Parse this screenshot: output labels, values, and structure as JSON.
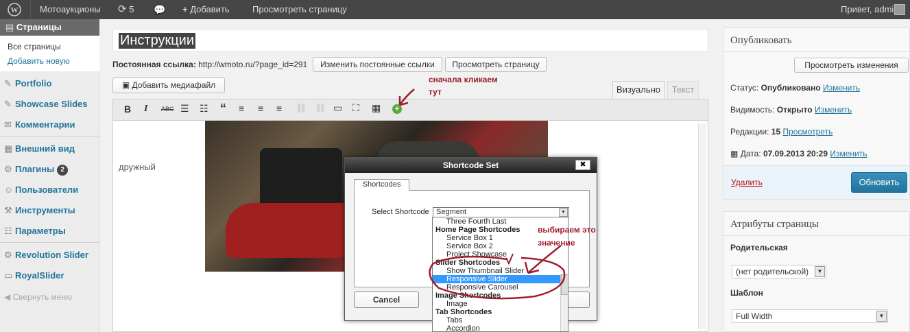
{
  "admin_bar": {
    "site_name": "Мотоаукционы",
    "updates_count": "5",
    "add_label": "Добавить",
    "view_page_label": "Просмотреть страницу",
    "greeting": "Привет, admin"
  },
  "sidebar": {
    "pages_label": "Страницы",
    "sub_items": [
      "Все страницы",
      "Добавить новую"
    ],
    "items": [
      {
        "label": "Portfolio",
        "icon": "✎"
      },
      {
        "label": "Showcase Slides",
        "icon": "✎"
      },
      {
        "label": "Комментарии",
        "icon": "✉"
      },
      {
        "label": "Внешний вид",
        "icon": "▦"
      },
      {
        "label": "Плагины",
        "icon": "⚙",
        "badge": "2"
      },
      {
        "label": "Пользователи",
        "icon": "☺"
      },
      {
        "label": "Инструменты",
        "icon": "⚒"
      },
      {
        "label": "Параметры",
        "icon": "☷"
      },
      {
        "label": "Revolution Slider",
        "icon": "⚙"
      },
      {
        "label": "RoyalSlider",
        "icon": "▭"
      }
    ],
    "collapse_label": "Свернуть меню"
  },
  "editor": {
    "title_value": "Инструкции",
    "permalink_label": "Постоянная ссылка:",
    "permalink_url": "http://wmoto.ru/?page_id=291",
    "change_permalink_btn": "Изменить постоянные ссылки",
    "view_page_btn": "Просмотреть страницу",
    "add_media_btn": "Добавить медиафайл",
    "tab_visual": "Визуально",
    "tab_text": "Текст",
    "content_text_fragment": "дружный"
  },
  "publish_box": {
    "title": "Опубликовать",
    "preview_btn": "Просмотреть изменения",
    "status_label": "Статус:",
    "status_value": "Опубликовано",
    "visibility_label": "Видимость:",
    "visibility_value": "Открыто",
    "revisions_label": "Редакции:",
    "revisions_value": "15",
    "revisions_link": "Просмотреть",
    "date_label": "Дата:",
    "date_value": "07.09.2013 20:29",
    "edit_link": "Изменить",
    "delete_link": "Удалить",
    "update_btn": "Обновить"
  },
  "attributes_box": {
    "title": "Атрибуты страницы",
    "parent_label": "Родительская",
    "parent_value": "(нет родительской)",
    "template_label": "Шаблон",
    "template_value": "Full Width"
  },
  "dialog": {
    "title": "Shortcode Set",
    "close": "✖",
    "tab": "Shortcodes",
    "select_label": "Select Shortcode",
    "selected_value": "Segment",
    "cancel_btn": "Cancel",
    "options": [
      {
        "text": "Three Fourth Last",
        "group": false,
        "highlight": false
      },
      {
        "text": "Home Page Shortcodes",
        "group": true,
        "highlight": false
      },
      {
        "text": "Service Box 1",
        "group": false,
        "highlight": false
      },
      {
        "text": "Service Box 2",
        "group": false,
        "highlight": false
      },
      {
        "text": "Project Showcase",
        "group": false,
        "highlight": false
      },
      {
        "text": "Slider Shortcodes",
        "group": true,
        "highlight": false
      },
      {
        "text": "Show Thumbnail Slider",
        "group": false,
        "highlight": false
      },
      {
        "text": "Responsive Slider",
        "group": false,
        "highlight": true
      },
      {
        "text": "Responsive Carousel",
        "group": false,
        "highlight": false
      },
      {
        "text": "Image Shortcodes",
        "group": true,
        "highlight": false
      },
      {
        "text": "Image",
        "group": false,
        "highlight": false
      },
      {
        "text": "Tab Shortcodes",
        "group": true,
        "highlight": false
      },
      {
        "text": "Tabs",
        "group": false,
        "highlight": false
      },
      {
        "text": "Accordion",
        "group": false,
        "highlight": false
      }
    ]
  },
  "annotations": {
    "click_here_line1": "сначала кликаем",
    "click_here_line2": "тут",
    "choose_line1": "выбираем это",
    "choose_line2": "значение",
    "color": "#a01c2c"
  },
  "colors": {
    "link": "#21759b",
    "update_btn": "#2e7fa8",
    "highlight": "#3399ff"
  }
}
